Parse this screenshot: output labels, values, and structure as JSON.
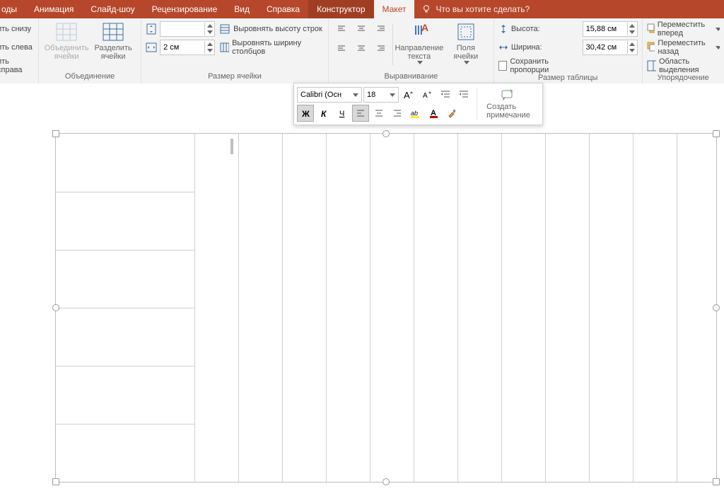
{
  "tabs": {
    "items": [
      "оды",
      "Анимация",
      "Слайд-шоу",
      "Рецензирование",
      "Вид",
      "Справка",
      "Конструктор",
      "Макет"
    ],
    "active_index": 7,
    "highlight_index": 6,
    "tell_me": "Что вы хотите сделать?"
  },
  "ribbon": {
    "insert": {
      "below": "ить снизу",
      "left": "ить слева",
      "right": "ить справа"
    },
    "merge": {
      "title": "Объединение",
      "merge": "Объединить\nячейки",
      "split": "Разделить\nячейки"
    },
    "cellsize": {
      "title": "Размер ячейки",
      "height_value": "",
      "width_value": "2 см",
      "dist_rows": "Выровнять высоту строк",
      "dist_cols": "Выровнять ширину столбцов"
    },
    "alignment": {
      "title": "Выравнивание",
      "text_dir": "Направление\nтекста",
      "margins": "Поля\nячейки"
    },
    "tablesize": {
      "title": "Размер таблицы",
      "height_label": "Высота:",
      "width_label": "Ширина:",
      "height_value": "15,88 см",
      "width_value": "30,42 см",
      "lock": "Сохранить пропорции"
    },
    "arrange": {
      "title": "Упорядочение",
      "front": "Переместить вперед",
      "back": "Переместить назад",
      "pane": "Область выделения"
    }
  },
  "minitoolbar": {
    "font": "Calibri (Осн",
    "size": "18",
    "new_comment": "Создать\nпримечание"
  }
}
